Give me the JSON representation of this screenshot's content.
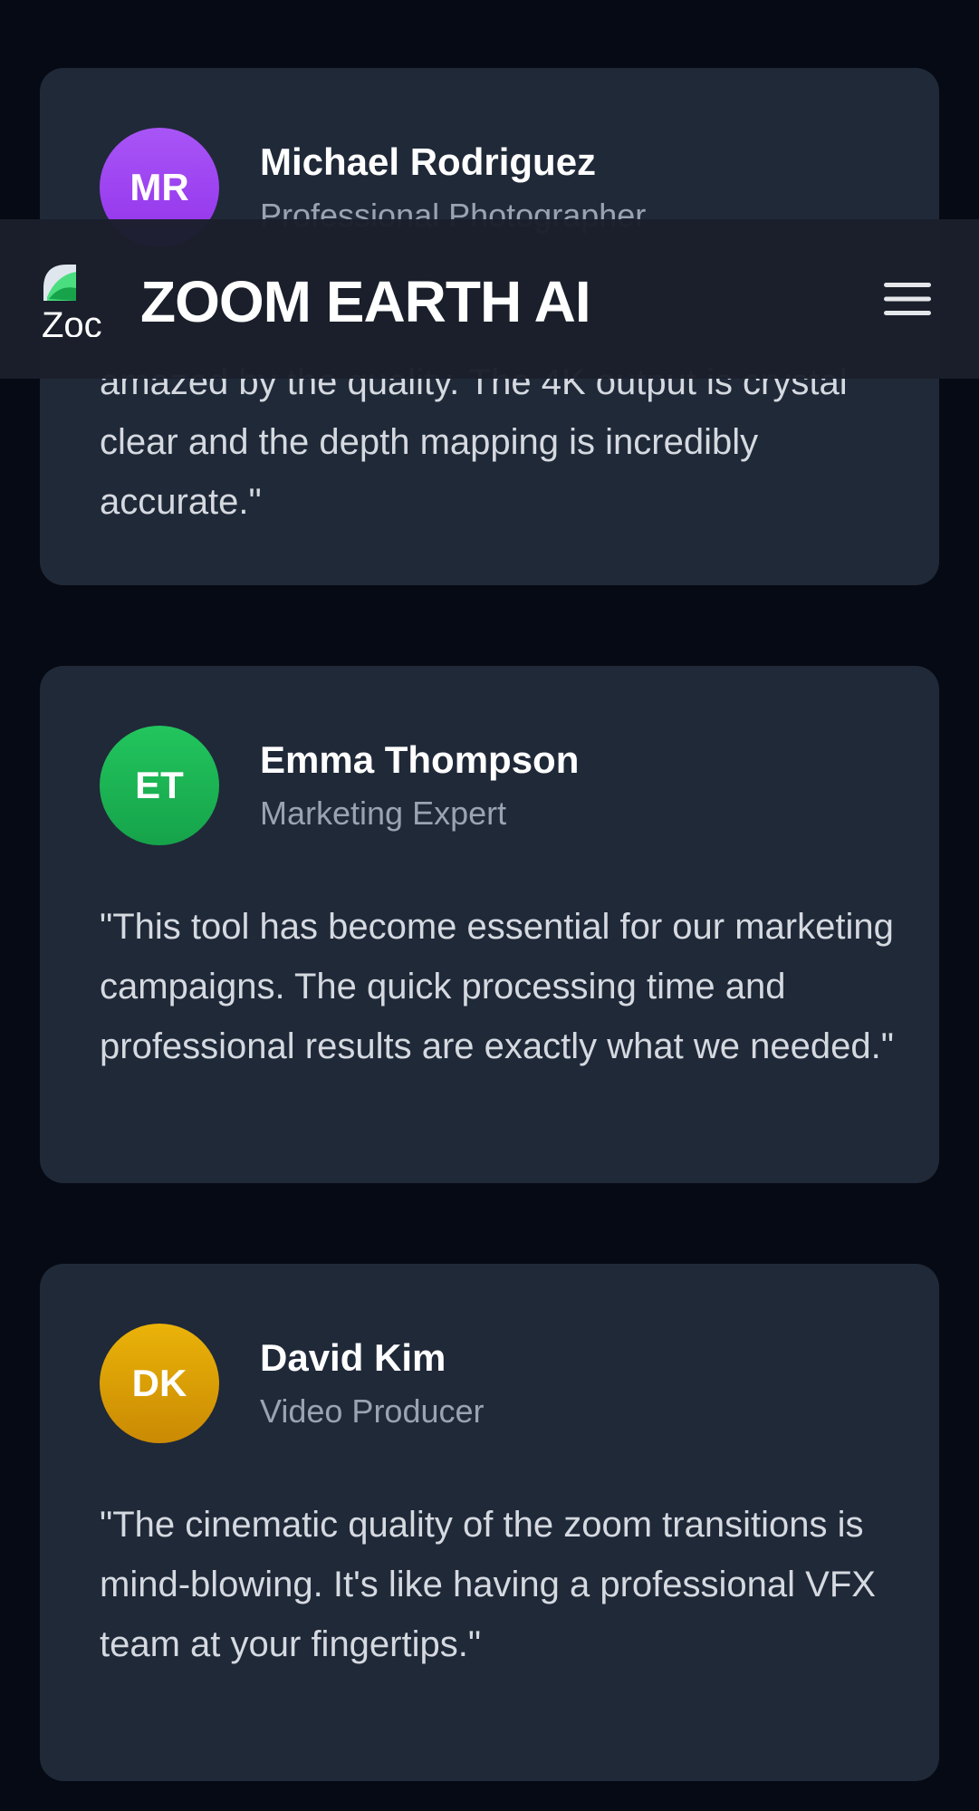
{
  "header": {
    "brand": "ZOOM EARTH AI",
    "logo_alt": "Zoc",
    "menu_icon": "hamburger-menu-icon"
  },
  "testimonials": [
    {
      "initials": "MR",
      "name": "Michael Rodriguez",
      "role": "Professional Photographer",
      "quote": "amazed by the quality. The 4K output is crystal clear and the depth mapping is incredibly accurate.\"",
      "avatar_color": "#a855f7"
    },
    {
      "initials": "ET",
      "name": "Emma Thompson",
      "role": "Marketing Expert",
      "quote": "\"This tool has become essential for our marketing campaigns. The quick processing time and professional results are exactly what we needed.\"",
      "avatar_color": "#22c55e"
    },
    {
      "initials": "DK",
      "name": "David Kim",
      "role": "Video Producer",
      "quote": "\"The cinematic quality of the zoom transitions is mind-blowing. It's like having a professional VFX team at your fingertips.\"",
      "avatar_color": "#eab308"
    }
  ],
  "colors": {
    "page_background": "#060a14",
    "card_background": "#202938",
    "header_background": "#1a1f2b",
    "name_text": "#ffffff",
    "role_text": "#9aa3b2",
    "quote_text": "#d5d9e0"
  }
}
